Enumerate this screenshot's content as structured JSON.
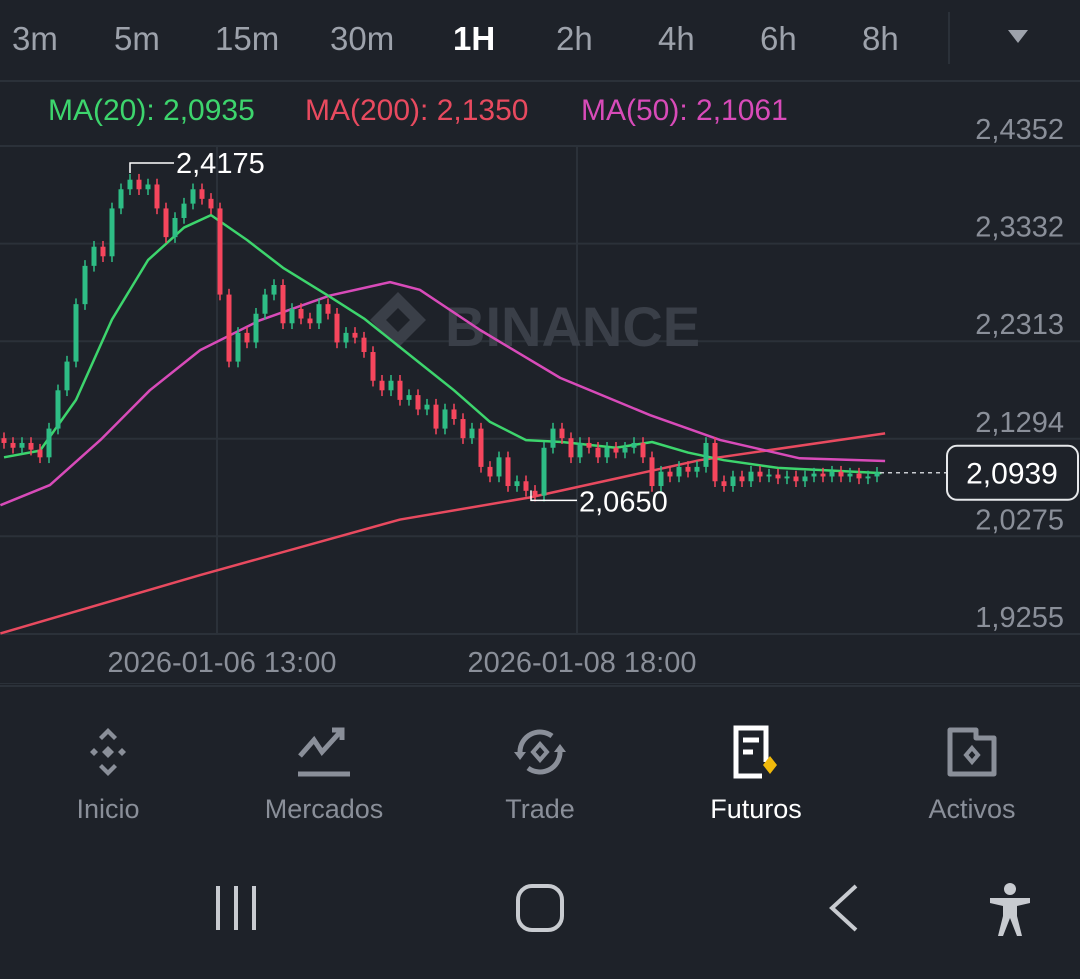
{
  "timeframes": [
    "3m",
    "5m",
    "15m",
    "30m",
    "1H",
    "2h",
    "4h",
    "6h",
    "8h"
  ],
  "active_timeframe": "1H",
  "indicators": [
    {
      "label": "MA(20): 2,0935",
      "color": "#3dd56d"
    },
    {
      "label": "MA(200): 2,1350",
      "color": "#e84a5f"
    },
    {
      "label": "MA(50): 2,1061",
      "color": "#d84bb9"
    }
  ],
  "watermark": "BINANCE",
  "colors": {
    "up": "#2ebd85",
    "down": "#f6465d",
    "ma20": "#3dd56d",
    "ma50": "#d84bb9",
    "ma200": "#e84a5f"
  },
  "chart_data": {
    "type": "candlestick",
    "y_ticks": [
      "2,4352",
      "2,3332",
      "2,2313",
      "2,1294",
      "2,0275",
      "1,9255"
    ],
    "y_tick_values": [
      2.4352,
      2.3332,
      2.2313,
      2.1294,
      2.0275,
      1.9255
    ],
    "x_ticks": [
      {
        "label": "2026-01-06 13:00",
        "index": 24
      },
      {
        "label": "2026-01-08 18:00",
        "index": 64
      }
    ],
    "high_label": {
      "text": "2,4175",
      "value": 2.4175,
      "index": 14
    },
    "low_label": {
      "text": "2,0650",
      "value": 2.065,
      "index": 59
    },
    "last_price": {
      "text": "2,0939",
      "value": 2.0939
    },
    "closes": [
      2.125,
      2.12,
      2.125,
      2.118,
      2.11,
      2.14,
      2.18,
      2.21,
      2.27,
      2.31,
      2.33,
      2.32,
      2.37,
      2.39,
      2.4,
      2.39,
      2.395,
      2.37,
      2.34,
      2.36,
      2.375,
      2.39,
      2.38,
      2.37,
      2.28,
      2.21,
      2.24,
      2.23,
      2.26,
      2.28,
      2.29,
      2.25,
      2.265,
      2.255,
      2.25,
      2.27,
      2.26,
      2.23,
      2.24,
      2.235,
      2.22,
      2.19,
      2.18,
      2.19,
      2.17,
      2.175,
      2.16,
      2.165,
      2.14,
      2.16,
      2.15,
      2.13,
      2.14,
      2.1,
      2.09,
      2.11,
      2.08,
      2.085,
      2.075,
      2.07,
      2.12,
      2.14,
      2.13,
      2.11,
      2.125,
      2.12,
      2.11,
      2.12,
      2.115,
      2.12,
      2.125,
      2.11,
      2.08,
      2.095,
      2.09,
      2.1,
      2.095,
      2.1,
      2.125,
      2.085,
      2.08,
      2.09,
      2.085,
      2.095,
      2.09,
      2.092,
      2.088,
      2.09,
      2.085,
      2.09,
      2.093,
      2.09,
      2.095,
      2.09,
      2.093,
      2.088,
      2.09,
      2.0939
    ],
    "ma20": [
      [
        0,
        2.11
      ],
      [
        4,
        2.117
      ],
      [
        8,
        2.17
      ],
      [
        12,
        2.254
      ],
      [
        16,
        2.316
      ],
      [
        20,
        2.35
      ],
      [
        23,
        2.363
      ],
      [
        27,
        2.337
      ],
      [
        31,
        2.308
      ],
      [
        36,
        2.279
      ],
      [
        40,
        2.255
      ],
      [
        46,
        2.21
      ],
      [
        50,
        2.18
      ],
      [
        54,
        2.147
      ],
      [
        58,
        2.128
      ],
      [
        62,
        2.126
      ],
      [
        68,
        2.12
      ],
      [
        72,
        2.126
      ],
      [
        76,
        2.115
      ],
      [
        80,
        2.107
      ],
      [
        86,
        2.099
      ],
      [
        97.5,
        2.0935
      ]
    ],
    "ma50": [
      [
        -0.4,
        2.06
      ],
      [
        5.1,
        2.081
      ],
      [
        10.7,
        2.128
      ],
      [
        16.2,
        2.18
      ],
      [
        21.8,
        2.222
      ],
      [
        28.4,
        2.253
      ],
      [
        36.2,
        2.279
      ],
      [
        42.9,
        2.293
      ],
      [
        46.2,
        2.285
      ],
      [
        52.9,
        2.243
      ],
      [
        61.8,
        2.193
      ],
      [
        71.8,
        2.154
      ],
      [
        79.6,
        2.128
      ],
      [
        88.4,
        2.109
      ],
      [
        97.9,
        2.1061
      ]
    ],
    "ma200": [
      [
        -0.4,
        1.926
      ],
      [
        21.8,
        1.987
      ],
      [
        44,
        2.045
      ],
      [
        58.4,
        2.068
      ],
      [
        77.3,
        2.107
      ],
      [
        97.9,
        2.135
      ]
    ]
  },
  "nav": [
    {
      "label": "Inicio",
      "icon": "binance-logo-icon"
    },
    {
      "label": "Mercados",
      "icon": "markets-chart-icon"
    },
    {
      "label": "Trade",
      "icon": "trade-exchange-icon"
    },
    {
      "label": "Futuros",
      "icon": "futures-document-icon"
    },
    {
      "label": "Activos",
      "icon": "wallet-icon"
    }
  ],
  "active_nav": "Futuros"
}
